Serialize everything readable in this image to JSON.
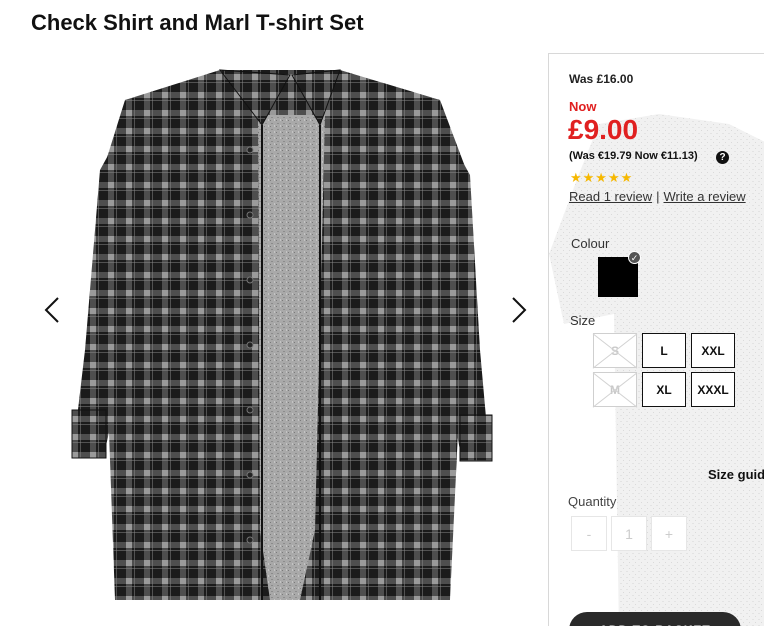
{
  "product": {
    "title": "Check Shirt and Marl T-shirt Set"
  },
  "pricing": {
    "was": "Was £16.00",
    "now_label": "Now",
    "now_price": "£9.00",
    "alt_currency": "(Was €19.79 Now €11.13)",
    "help_icon": "?"
  },
  "rating": {
    "stars": "★★★★★",
    "value": 5,
    "max": 5
  },
  "reviews": {
    "read": "Read 1 review",
    "separator": "|",
    "write": "Write a review"
  },
  "colour": {
    "label": "Colour",
    "selected_hex": "#000000",
    "check": "✓"
  },
  "size": {
    "label": "Size",
    "options": [
      {
        "label": "S",
        "available": false
      },
      {
        "label": "L",
        "available": true
      },
      {
        "label": "XXL",
        "available": true
      },
      {
        "label": "M",
        "available": false
      },
      {
        "label": "XL",
        "available": true
      },
      {
        "label": "XXXL",
        "available": true
      }
    ],
    "guide": "Size guide"
  },
  "quantity": {
    "label": "Quantity",
    "minus": "-",
    "value": "1",
    "plus": "+"
  },
  "basket": {
    "label": "ADD TO BASKET"
  },
  "colors": {
    "price_red": "#e02020",
    "star_gold": "#f6b800"
  }
}
